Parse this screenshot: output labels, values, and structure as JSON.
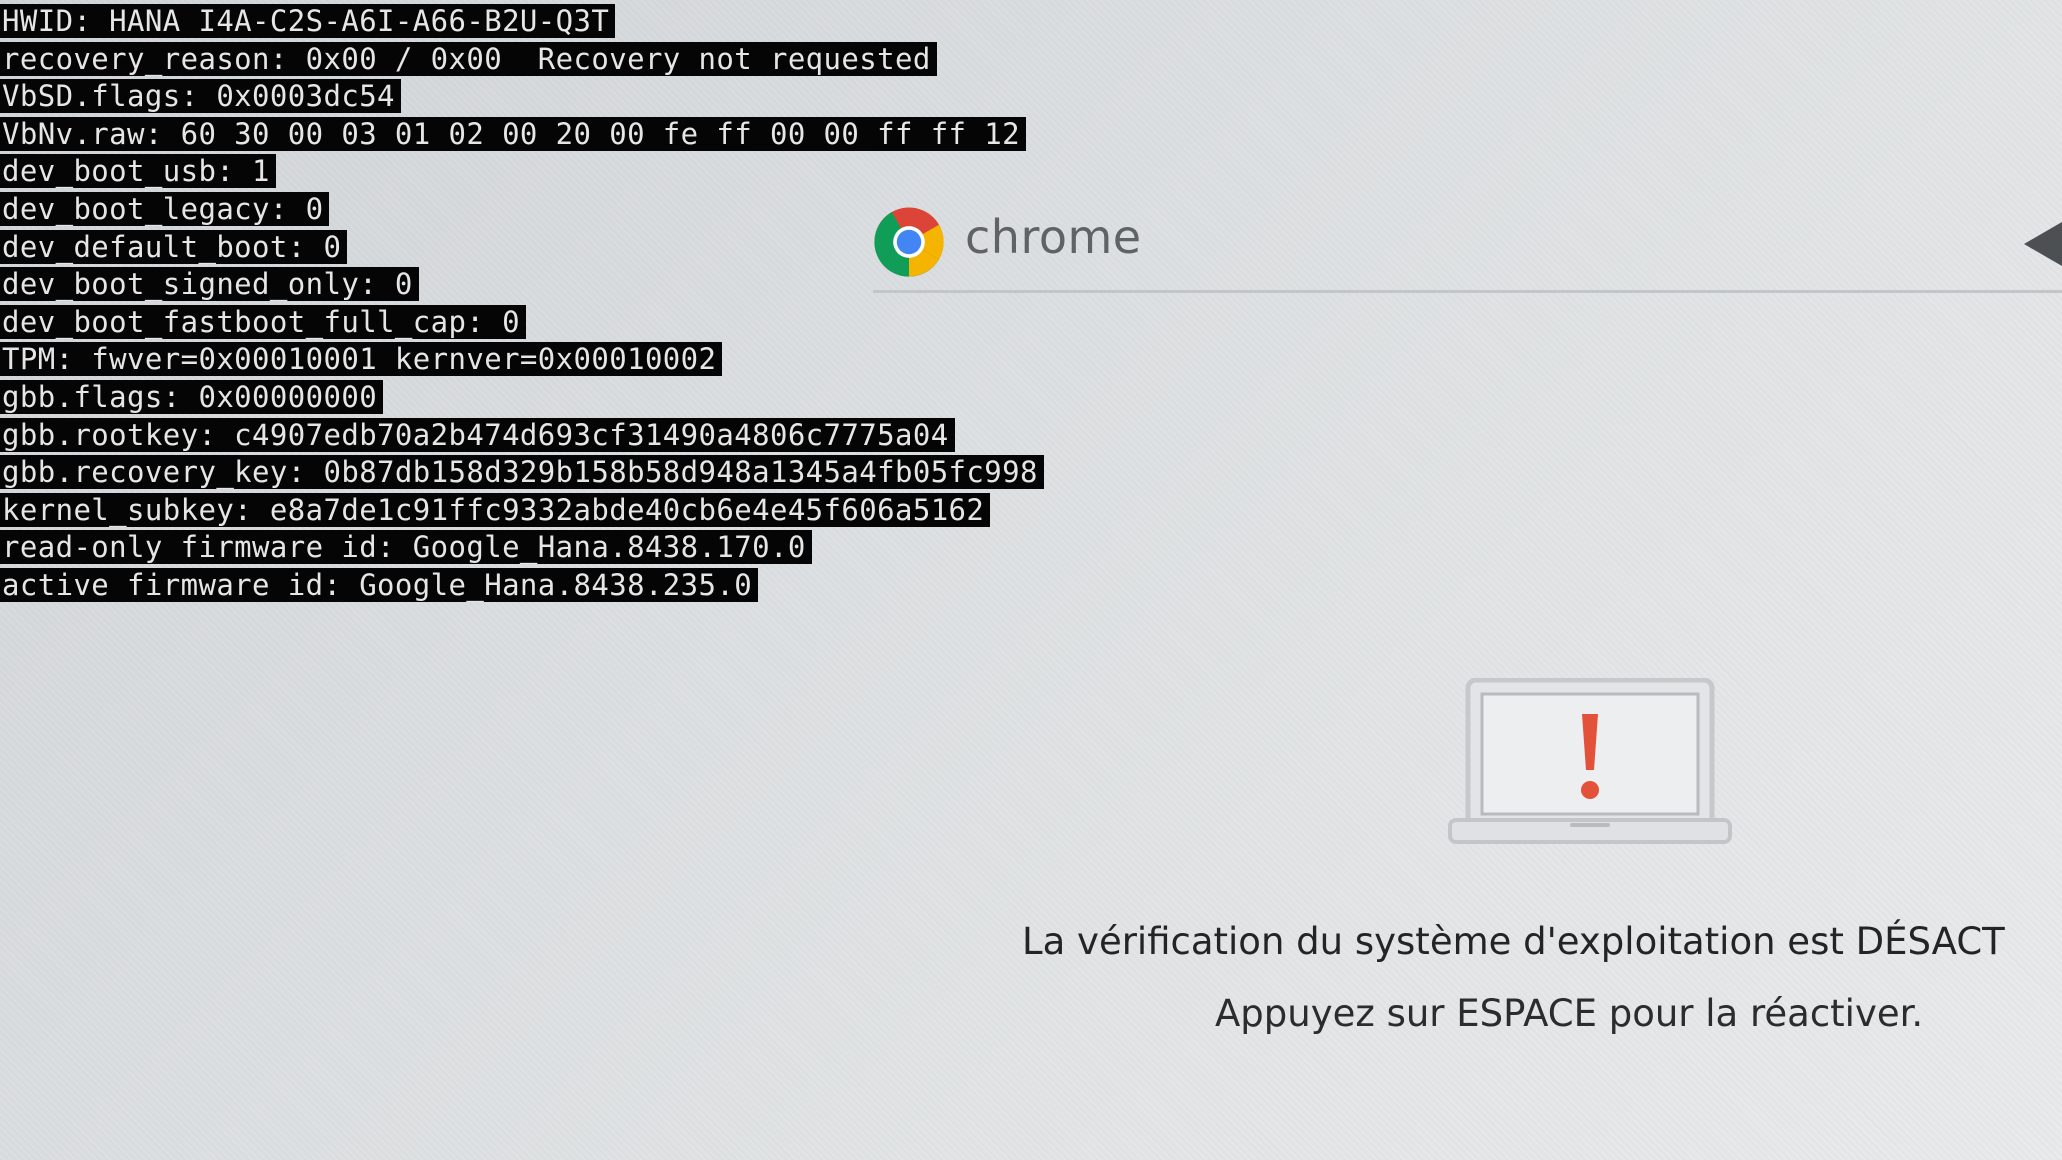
{
  "debug_info": [
    "HWID: HANA I4A-C2S-A6I-A66-B2U-Q3T",
    "recovery_reason: 0x00 / 0x00  Recovery not requested",
    "VbSD.flags: 0x0003dc54",
    "VbNv.raw: 60 30 00 03 01 02 00 20 00 fe ff 00 00 ff ff 12",
    "dev_boot_usb: 1",
    "dev_boot_legacy: 0",
    "dev_default_boot: 0",
    "dev_boot_signed_only: 0",
    "dev_boot_fastboot_full_cap: 0",
    "TPM: fwver=0x00010001 kernver=0x00010002",
    "gbb.flags: 0x00000000",
    "gbb.rootkey: c4907edb70a2b474d693cf31490a4806c7775a04",
    "gbb.recovery_key: 0b87db158d329b158b58d948a1345a4fb05fc998",
    "kernel_subkey: e8a7de1c91ffc9332abde40cb6e4e45f606a5162",
    "read-only firmware id: Google_Hana.8438.170.0",
    "active firmware id: Google_Hana.8438.235.0"
  ],
  "header": {
    "brand": "chrome",
    "logo_icon": "chrome-logo-icon",
    "language_icon": "language-arrow-icon"
  },
  "illustration": {
    "icon": "laptop-warning-icon",
    "accent_color": "#e4513a"
  },
  "message": {
    "main": "La vérification du système d'exploitation est DÉSACT",
    "sub": "Appuyez sur ESPACE pour la réactiver."
  }
}
